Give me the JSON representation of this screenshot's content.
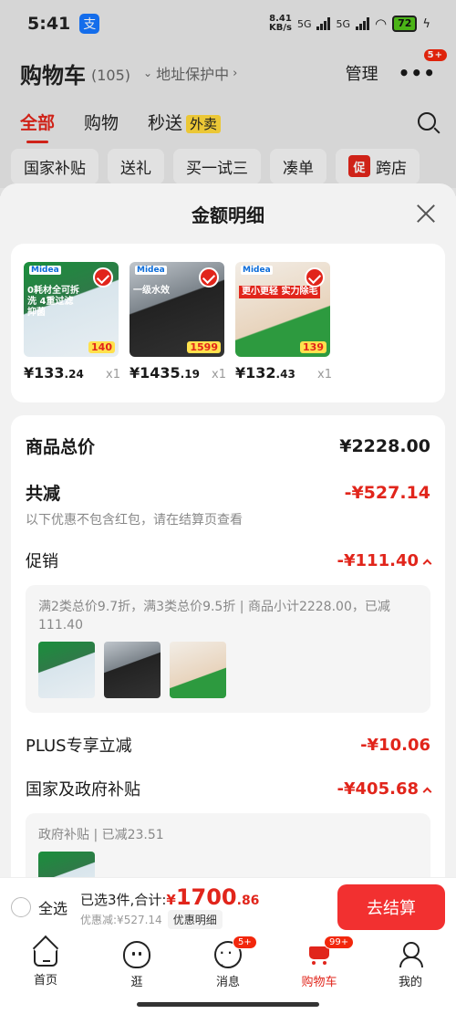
{
  "status": {
    "time": "5:41",
    "alipay": "支",
    "net_top": "8.41",
    "net_bottom": "KB/s",
    "sim1": "5G",
    "sim2": "5G",
    "battery": "72"
  },
  "header": {
    "title": "购物车",
    "count": "(105)",
    "address": "地址保护中",
    "manage": "管理",
    "more_badge": "5+"
  },
  "tabs": {
    "all": "全部",
    "shopping": "购物",
    "flash": "秒送",
    "takeaway": "外卖"
  },
  "chips": [
    "国家补贴",
    "送礼",
    "买一试三",
    "凑单"
  ],
  "chip_cross": {
    "icon": "促",
    "label": "跨店"
  },
  "sheet": {
    "title": "金额明细",
    "products": [
      {
        "brand": "Midea",
        "headline": "0耗材全可拆洗 4重过滤抑菌",
        "badge": "140",
        "price_int": "¥133",
        "price_dec": ".24",
        "qty": "x1"
      },
      {
        "brand": "Midea",
        "headline": "一级水效",
        "badge": "1599",
        "price_int": "¥1435",
        "price_dec": ".19",
        "qty": "x1"
      },
      {
        "brand": "Midea",
        "headline": "更小更轻 实力除毛",
        "badge": "139",
        "price_int": "¥132",
        "price_dec": ".43",
        "qty": "x1"
      }
    ],
    "total_label": "商品总价",
    "total_value": "¥2228.00",
    "reduce_label": "共减",
    "reduce_value": "-¥527.14",
    "reduce_note": "以下优惠不包含红包，请在结算页查看",
    "promo_label": "促销",
    "promo_value": "-¥111.40",
    "promo_desc": "满2类总价9.7折，满3类总价9.5折 | 商品小计2228.00，已减111.40",
    "plus_label": "PLUS专享立减",
    "plus_value": "-¥10.06",
    "gov_label": "国家及政府补贴",
    "gov_value": "-¥405.68",
    "gov_desc": "政府补贴 | 已减23.51"
  },
  "checkout": {
    "select_all": "全选",
    "selected": "已选3件,合计:",
    "currency": "¥",
    "amount_int": "1700",
    "amount_dec": ".86",
    "discount": "优惠减:¥527.14",
    "detail_button": "优惠明细",
    "submit": "去结算"
  },
  "nav": [
    {
      "label": "首页"
    },
    {
      "label": "逛"
    },
    {
      "label": "消息",
      "badge": "5+"
    },
    {
      "label": "购物车",
      "badge": "99+"
    },
    {
      "label": "我的"
    }
  ],
  "colors": {
    "accent": "#e1251b",
    "button": "#f23030",
    "takeaway_tag": "#ffd83b"
  }
}
